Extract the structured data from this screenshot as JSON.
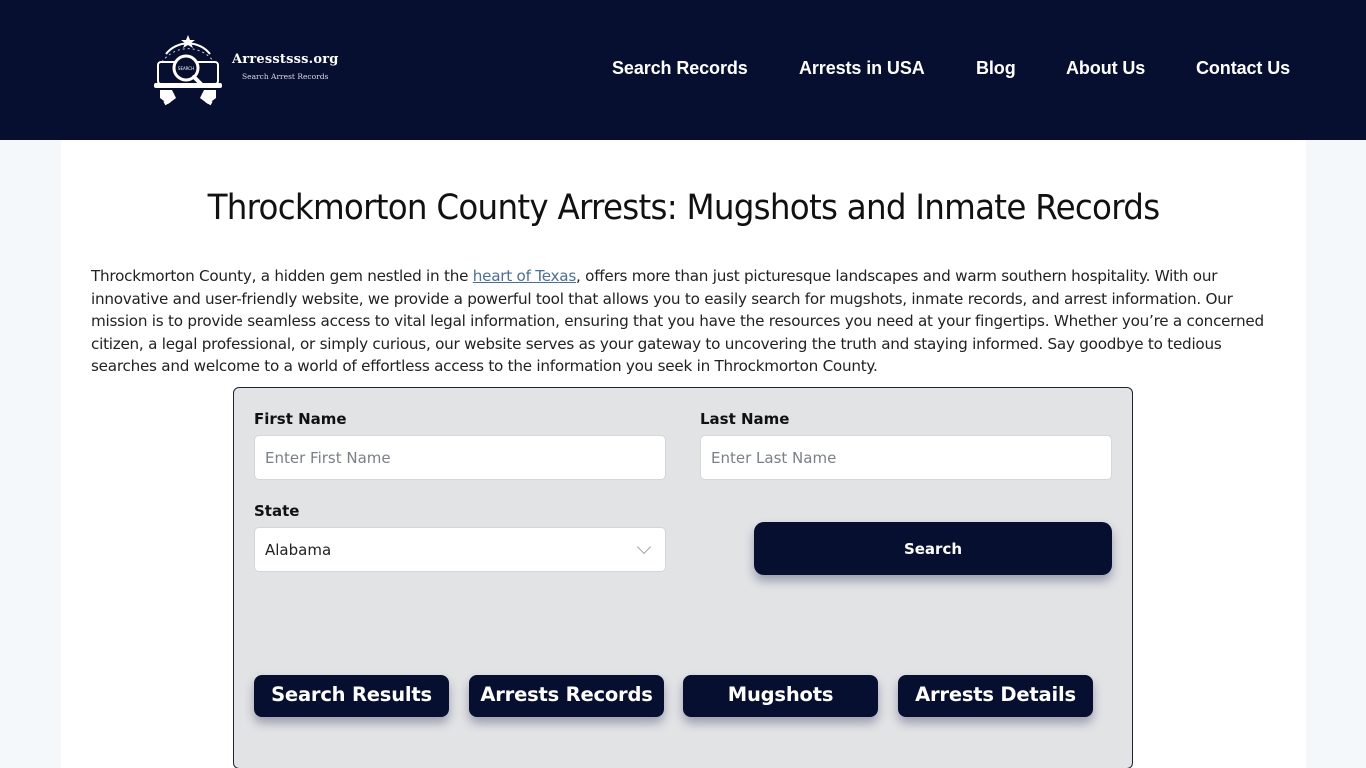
{
  "header": {
    "logo": {
      "title": "Arresstsss.org",
      "subtitle": "Search Arrest Records",
      "badge_text": "SEARCH",
      "icon": "magnifier-badge-icon"
    },
    "nav": [
      {
        "label": "Search Records"
      },
      {
        "label": "Arrests in USA"
      },
      {
        "label": "Blog"
      },
      {
        "label": "About Us"
      },
      {
        "label": "Contact Us"
      }
    ]
  },
  "main": {
    "title": "Throckmorton County Arrests: Mugshots and Inmate Records",
    "intro": {
      "before_link": "Throckmorton County, a hidden gem nestled in the ",
      "link_text": "heart of Texas",
      "after_link": ", offers more than just picturesque landscapes and warm southern hospitality. With our innovative and user-friendly website, we provide a powerful tool that allows you to easily search for mugshots, inmate records, and arrest information. Our mission is to provide seamless access to vital legal information, ensuring that you have the resources you need at your fingertips. Whether you’re a concerned citizen, a legal professional, or simply curious, our website serves as your gateway to uncovering the truth and staying informed. Say goodbye to tedious searches and welcome to a world of effortless access to the information you seek in Throckmorton County."
    }
  },
  "search_form": {
    "first_name": {
      "label": "First Name",
      "placeholder": "Enter First Name",
      "value": ""
    },
    "last_name": {
      "label": "Last Name",
      "placeholder": "Enter Last Name",
      "value": ""
    },
    "state": {
      "label": "State",
      "selected": "Alabama"
    },
    "search_button": "Search",
    "tabs": [
      {
        "label": "Search Results"
      },
      {
        "label": "Arrests Records"
      },
      {
        "label": "Mugshots"
      },
      {
        "label": "Arrests Details"
      }
    ]
  },
  "colors": {
    "brand_navy": "#060f30",
    "page_bg": "#f5f8fb",
    "form_bg": "#e2e3e5",
    "link": "#4a6f9e"
  }
}
